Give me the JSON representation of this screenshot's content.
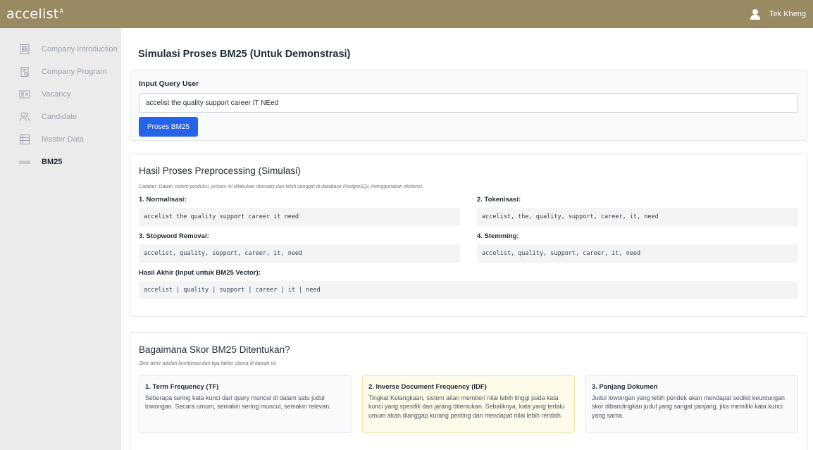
{
  "topbar": {
    "logo": "accelist",
    "logo_mark": "A",
    "user_name": "Tek Kheng"
  },
  "sidebar": {
    "items": [
      {
        "label": "Company Introduction",
        "icon": "building-icon"
      },
      {
        "label": "Company Program",
        "icon": "document-search-icon"
      },
      {
        "label": "Vacancy",
        "icon": "id-card-icon"
      },
      {
        "label": "Candidate",
        "icon": "users-icon"
      },
      {
        "label": "Master Data",
        "icon": "list-icon"
      },
      {
        "label": "BM25",
        "icon": "bar-icon",
        "active": true
      }
    ]
  },
  "page": {
    "title": "Simulasi Proses BM25 (Untuk Demonstrasi)"
  },
  "query": {
    "label": "Input Query User",
    "value": "accelist the quality support career IT NEed",
    "button": "Proses BM25"
  },
  "preprocessing": {
    "title": "Hasil Proses Preprocessing (Simulasi)",
    "note": "Catatan: Dalam sistem produksi, proses ini dilakukan otomatis dan lebih canggih di database PostgreSQL menggunakan ekstensi.",
    "normalisasi": {
      "label": "1. Normalisasi:",
      "value": "accelist the quality support career it need"
    },
    "tokenisasi": {
      "label": "2. Tokenisasi:",
      "value": "accelist, the, quality, support, career, it, need"
    },
    "stopword": {
      "label": "3. Stopword Removal:",
      "value": "accelist, quality, support, career, it, need"
    },
    "stemming": {
      "label": "4. Stemming:",
      "value": "accelist, quality, support, career, it, need"
    },
    "final": {
      "label": "Hasil Akhir (Input untuk BM25 Vector):",
      "value": "accelist | quality | support | career | it | need"
    }
  },
  "score": {
    "title": "Bagaimana Skor BM25 Ditentukan?",
    "note": "Skor akhir adalah kombinasi dari tiga faktor utama di bawah ini.",
    "factors": [
      {
        "title": "1. Term Frequency (TF)",
        "body": "Seberapa sering kata kunci dari query muncul di dalam satu judul lowongan. Secara umum, semakin sering muncul, semakin relevan."
      },
      {
        "title": "2. Inverse Document Frequency (IDF)",
        "body": "Tingkat Kelangkaan, sistem akan memberi nilai lebih tinggi pada kata kunci yang spesifik dan jarang ditemukan. Sebaliknya, kata yang terlalu umum akan dianggap kurang penting dan mendapat nilai lebih rendah."
      },
      {
        "title": "3. Panjang Dokumen",
        "body": "Judul lowongan yang lebih pendek akan mendapat sedikit keuntungan skor dibandingkan judul yang sangat panjang, jika memiliki kata kunci yang sama."
      }
    ]
  },
  "colors": {
    "topbar": "#9a8a62",
    "primary": "#2563eb",
    "highlight": "#fffbeb"
  }
}
